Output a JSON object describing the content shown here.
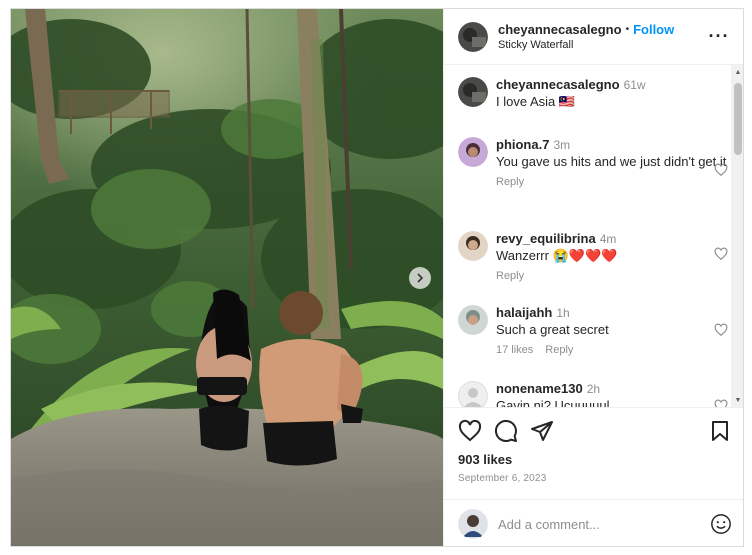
{
  "post": {
    "author": "cheyannecasalegno",
    "follow_label": "Follow",
    "location": "Sticky Waterfall",
    "separator": "•"
  },
  "comments": [
    {
      "user": "cheyannecasalegno",
      "time": "61w",
      "text": "I love Asia 🇲🇾",
      "likes": "",
      "reply": ""
    },
    {
      "user": "phiona.7",
      "time": "3m",
      "text": "You gave us hits and we just didn't get it",
      "likes": "",
      "reply": "Reply"
    },
    {
      "user": "revy_equilibrina",
      "time": "4m",
      "text": "Wanzerrr 😭❤️❤️❤️",
      "likes": "",
      "reply": "Reply"
    },
    {
      "user": "halaijahh",
      "time": "1h",
      "text": "Such a great secret",
      "likes": "17 likes",
      "reply": "Reply"
    },
    {
      "user": "nonename130",
      "time": "2h",
      "text": "Gavin ni? Ucuuuuul",
      "likes": "",
      "reply": ""
    }
  ],
  "stats": {
    "likes": "903 likes",
    "date": "September 6, 2023"
  },
  "composer": {
    "placeholder": "Add a comment..."
  },
  "icons": {
    "more": "more-options-icon",
    "like": "heart-icon",
    "comment": "comment-bubble-icon",
    "share": "paper-plane-icon",
    "save": "bookmark-icon",
    "emoji": "emoji-smile-icon",
    "next": "chevron-right-icon"
  },
  "colors": {
    "accent": "#0095f6",
    "muted": "#8e8e8e",
    "border": "#dbdbdb"
  }
}
